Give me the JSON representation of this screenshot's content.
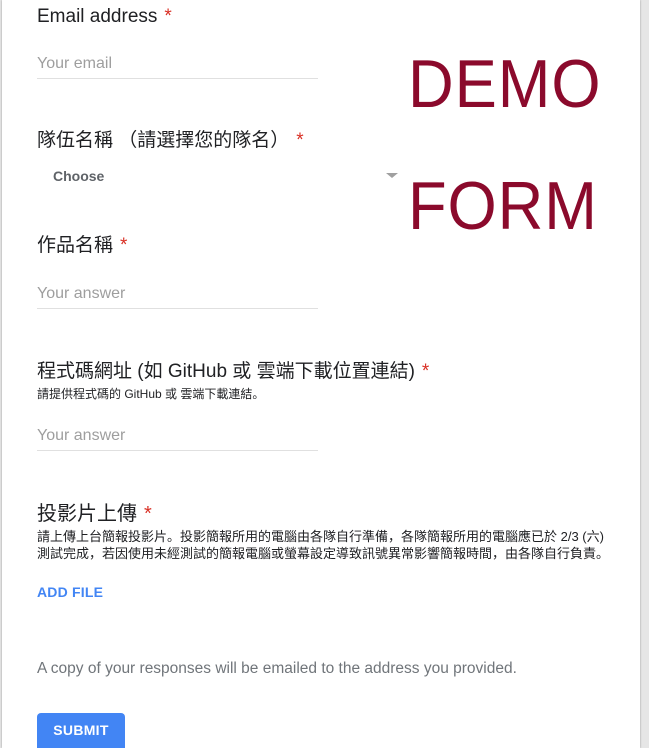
{
  "colors": {
    "text": "#202124",
    "required": "#d93025",
    "placeholder": "#9e9e9e",
    "divider": "#e0e0e0",
    "accent": "#4285f4",
    "notice": "#70757a",
    "watermark": "#8b0a2c"
  },
  "watermark": {
    "line1": "DEMO",
    "line2": "FORM"
  },
  "questions": {
    "email": {
      "title": "Email address",
      "required_mark": "*",
      "placeholder": "Your email",
      "value": ""
    },
    "team": {
      "title": "隊伍名稱 （請選擇您的隊名）",
      "required_mark": "*",
      "selected": "Choose",
      "icon": "dropdown-arrow-icon"
    },
    "work_name": {
      "title": "作品名稱",
      "required_mark": "*",
      "placeholder": "Your answer",
      "value": ""
    },
    "code_url": {
      "title": "程式碼網址 (如 GitHub 或 雲端下載位置連結)",
      "required_mark": "*",
      "description": "請提供程式碼的 GitHub 或 雲端下載連結。",
      "placeholder": "Your answer",
      "value": ""
    },
    "slides": {
      "title": "投影片上傳",
      "required_mark": "*",
      "description_lines": [
        "請上傳上台簡報投影片。投影簡報所用的電腦由各隊自行準備，各隊簡報所用的電腦應已於 2/3 (六)",
        "測試完成，若因使用未經測試的簡報電腦或螢幕設定導致訊號異常影響簡報時間，由各隊自行負責。"
      ],
      "add_file_label": "ADD FILE"
    }
  },
  "footer": {
    "copy_notice": "A copy of your responses will be emailed to the address you provided.",
    "submit_label": "SUBMIT"
  }
}
